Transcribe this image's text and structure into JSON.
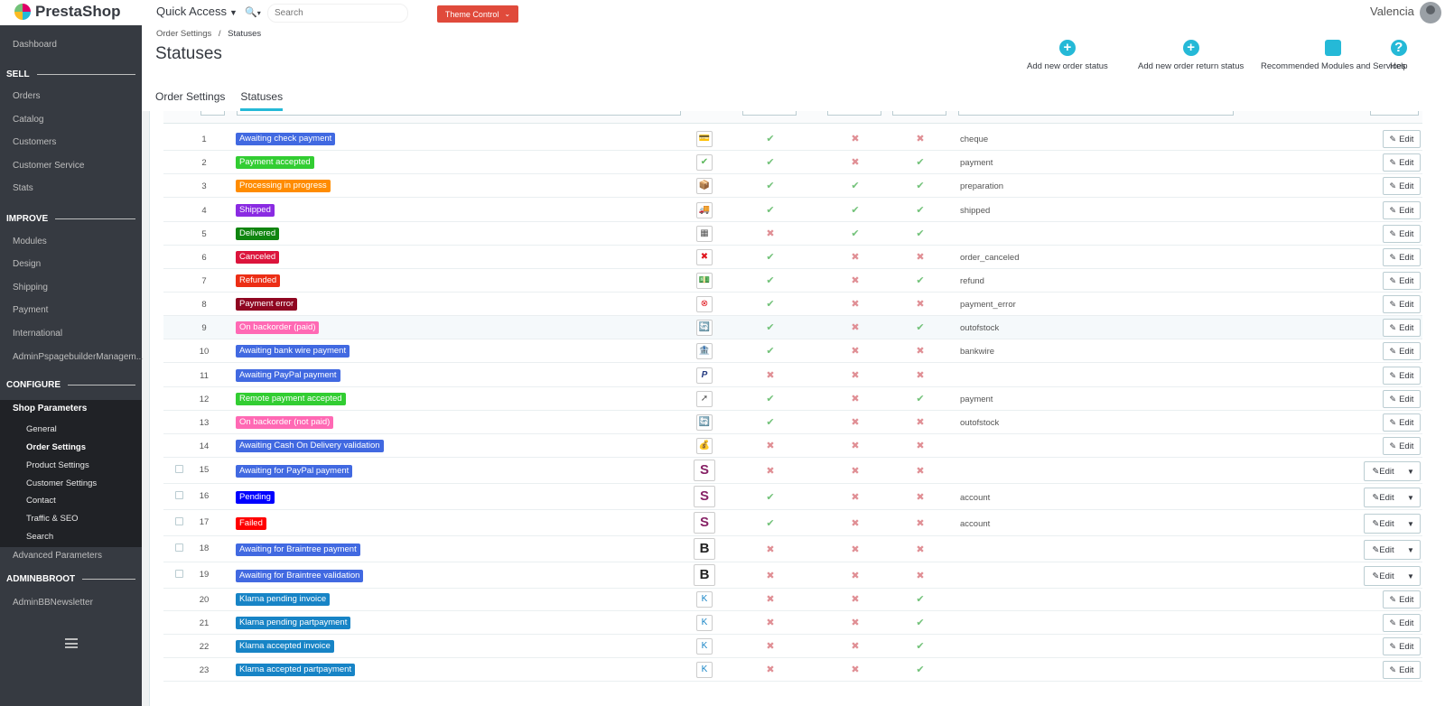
{
  "topbar": {
    "logo_text": "PrestaShop",
    "quick_access_label": "Quick Access",
    "search_placeholder": "Search",
    "theme_control_label": "Theme Control",
    "user_name": "Valencia"
  },
  "sidebar": {
    "dashboard": "Dashboard",
    "sections": {
      "sell": "SELL",
      "improve": "IMPROVE",
      "configure": "CONFIGURE",
      "adminbbroot": "ADMINBBROOT"
    },
    "sell_items": [
      "Orders",
      "Catalog",
      "Customers",
      "Customer Service",
      "Stats"
    ],
    "improve_items": [
      "Modules",
      "Design",
      "Shipping",
      "Payment",
      "International",
      "AdminPspagebuilderManagem..."
    ],
    "configure_active": "Shop Parameters",
    "shop_params_sub": [
      "General",
      "Order Settings",
      "Product Settings",
      "Customer Settings",
      "Contact",
      "Traffic & SEO",
      "Search"
    ],
    "advanced": "Advanced Parameters",
    "admin_newsletter": "AdminBBNewsletter"
  },
  "header": {
    "breadcrumb_parent": "Order Settings",
    "breadcrumb_sep": "/",
    "breadcrumb_current": "Statuses",
    "page_title": "Statuses",
    "toolbar": {
      "add_order_status": "Add new order status",
      "add_return_status": "Add new order return status",
      "recommended": "Recommended Modules and Services",
      "help": "Help"
    },
    "tabs": [
      "Order Settings",
      "Statuses"
    ]
  },
  "table": {
    "edit_label": "Edit",
    "rows": [
      {
        "id": "1",
        "name": "Awaiting check payment",
        "color": "#4169e1",
        "icon": "cheque-icon",
        "glyph": "💳",
        "send_email": true,
        "delivery": false,
        "invoice": false,
        "template": "cheque",
        "checkbox": false
      },
      {
        "id": "2",
        "name": "Payment accepted",
        "color": "#32cd32",
        "icon": "check-icon",
        "glyph": "✔",
        "send_email": true,
        "delivery": false,
        "invoice": true,
        "template": "payment",
        "checkbox": false
      },
      {
        "id": "3",
        "name": "Processing in progress",
        "color": "#ff8c00",
        "icon": "box-icon",
        "glyph": "📦",
        "send_email": true,
        "delivery": true,
        "invoice": true,
        "template": "preparation",
        "checkbox": false
      },
      {
        "id": "4",
        "name": "Shipped",
        "color": "#8a2be2",
        "icon": "truck-icon",
        "glyph": "🚚",
        "send_email": true,
        "delivery": true,
        "invoice": true,
        "template": "shipped",
        "checkbox": false
      },
      {
        "id": "5",
        "name": "Delivered",
        "color": "#108510",
        "icon": "package-icon",
        "glyph": "▦",
        "send_email": false,
        "delivery": true,
        "invoice": true,
        "template": "",
        "checkbox": false
      },
      {
        "id": "6",
        "name": "Canceled",
        "color": "#dc143c",
        "icon": "cross-icon",
        "glyph": "✖",
        "send_email": true,
        "delivery": false,
        "invoice": false,
        "template": "order_canceled",
        "checkbox": false
      },
      {
        "id": "7",
        "name": "Refunded",
        "color": "#ec2e15",
        "icon": "money-icon",
        "glyph": "💵",
        "send_email": true,
        "delivery": false,
        "invoice": true,
        "template": "refund",
        "checkbox": false
      },
      {
        "id": "8",
        "name": "Payment error",
        "color": "#8f0621",
        "icon": "error-icon",
        "glyph": "⊗",
        "send_email": true,
        "delivery": false,
        "invoice": false,
        "template": "payment_error",
        "checkbox": false
      },
      {
        "id": "9",
        "name": "On backorder (paid)",
        "color": "#ff69b4",
        "icon": "backorder-icon",
        "glyph": "🔄",
        "send_email": true,
        "delivery": false,
        "invoice": true,
        "template": "outofstock",
        "checkbox": false,
        "highlight": true
      },
      {
        "id": "10",
        "name": "Awaiting bank wire payment",
        "color": "#4169e1",
        "icon": "bank-icon",
        "glyph": "🏦",
        "send_email": true,
        "delivery": false,
        "invoice": false,
        "template": "bankwire",
        "checkbox": false
      },
      {
        "id": "11",
        "name": "Awaiting PayPal payment",
        "color": "#4169e1",
        "icon": "paypal-icon",
        "glyph": "P",
        "send_email": false,
        "delivery": false,
        "invoice": false,
        "template": "",
        "checkbox": false
      },
      {
        "id": "12",
        "name": "Remote payment accepted",
        "color": "#32cd32",
        "icon": "remote-icon",
        "glyph": "➚",
        "send_email": true,
        "delivery": false,
        "invoice": true,
        "template": "payment",
        "checkbox": false
      },
      {
        "id": "13",
        "name": "On backorder (not paid)",
        "color": "#ff69b4",
        "icon": "backorder-icon",
        "glyph": "🔄",
        "send_email": true,
        "delivery": false,
        "invoice": false,
        "template": "outofstock",
        "checkbox": false
      },
      {
        "id": "14",
        "name": "Awaiting Cash On Delivery validation",
        "color": "#4169e1",
        "icon": "cash-icon",
        "glyph": "💰",
        "send_email": false,
        "delivery": false,
        "invoice": false,
        "template": "",
        "checkbox": false
      },
      {
        "id": "15",
        "name": "Awaiting for PayPal payment",
        "color": "#4169e1",
        "icon": "skrill-icon",
        "glyph": "S",
        "send_email": false,
        "delivery": false,
        "invoice": false,
        "template": "",
        "checkbox": true
      },
      {
        "id": "16",
        "name": "Pending",
        "color": "#0000ff",
        "icon": "skrill-icon",
        "glyph": "S",
        "send_email": true,
        "delivery": false,
        "invoice": false,
        "template": "account",
        "checkbox": true
      },
      {
        "id": "17",
        "name": "Failed",
        "color": "#ff0000",
        "icon": "skrill-icon",
        "glyph": "S",
        "send_email": true,
        "delivery": false,
        "invoice": false,
        "template": "account",
        "checkbox": true
      },
      {
        "id": "18",
        "name": "Awaiting for Braintree payment",
        "color": "#4169e1",
        "icon": "braintree-icon",
        "glyph": "B",
        "send_email": false,
        "delivery": false,
        "invoice": false,
        "template": "",
        "checkbox": true
      },
      {
        "id": "19",
        "name": "Awaiting for Braintree validation",
        "color": "#4169e1",
        "icon": "braintree-icon",
        "glyph": "B",
        "send_email": false,
        "delivery": false,
        "invoice": false,
        "template": "",
        "checkbox": true
      },
      {
        "id": "20",
        "name": "Klarna pending invoice",
        "color": "#1784c6",
        "icon": "klarna-icon",
        "glyph": "K",
        "send_email": false,
        "delivery": false,
        "invoice": true,
        "template": "",
        "checkbox": false
      },
      {
        "id": "21",
        "name": "Klarna pending partpayment",
        "color": "#1784c6",
        "icon": "klarna-icon",
        "glyph": "K",
        "send_email": false,
        "delivery": false,
        "invoice": true,
        "template": "",
        "checkbox": false
      },
      {
        "id": "22",
        "name": "Klarna accepted invoice",
        "color": "#1784c6",
        "icon": "klarna-icon",
        "glyph": "K",
        "send_email": false,
        "delivery": false,
        "invoice": true,
        "template": "",
        "checkbox": false
      },
      {
        "id": "23",
        "name": "Klarna accepted partpayment",
        "color": "#1784c6",
        "icon": "klarna-icon",
        "glyph": "K",
        "send_email": false,
        "delivery": false,
        "invoice": true,
        "template": "",
        "checkbox": false
      }
    ]
  },
  "colors": {
    "accent": "#25b9d7",
    "sidebar_bg": "#363a41",
    "check_ok": "#72c279",
    "check_no": "#e08f95"
  }
}
